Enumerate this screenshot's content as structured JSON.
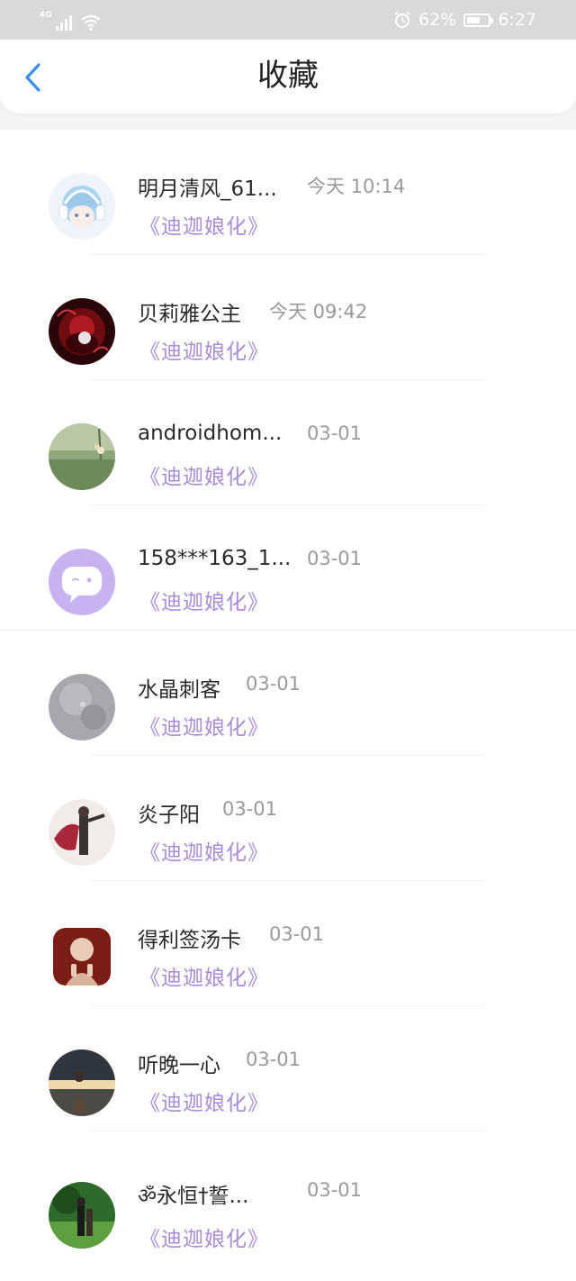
{
  "status_bar": {
    "network": "4G",
    "battery": "62%",
    "battery_level": 0.62,
    "time": "6:27"
  },
  "header": {
    "title": "收藏",
    "back_icon": "chevron-left-icon"
  },
  "colors": {
    "accent": "#3a8ee6",
    "work_title": "#a98cd6",
    "bubble": "#c9b2f0"
  },
  "favorites": [
    {
      "name": "明月清风_61...",
      "time": "今天 10:14",
      "work": "《迪迦娘化》"
    },
    {
      "name": "贝莉雅公主",
      "time": "今天 09:42",
      "work": "《迪迦娘化》"
    },
    {
      "name": "androidhom...",
      "time": "03-01",
      "work": "《迪迦娘化》"
    },
    {
      "name": "158***163_1...",
      "time": "03-01",
      "work": "《迪迦娘化》"
    },
    {
      "name": "水晶刺客",
      "time": "03-01",
      "work": "《迪迦娘化》"
    },
    {
      "name": "炎子阳",
      "time": "03-01",
      "work": "《迪迦娘化》"
    },
    {
      "name": "得利签汤卡",
      "time": "03-01",
      "work": "《迪迦娘化》"
    },
    {
      "name": "听晚一心",
      "time": "03-01",
      "work": "《迪迦娘化》"
    },
    {
      "name": "ॐ永恒†誓...",
      "time": "03-01",
      "work": "《迪迦娘化》"
    }
  ]
}
